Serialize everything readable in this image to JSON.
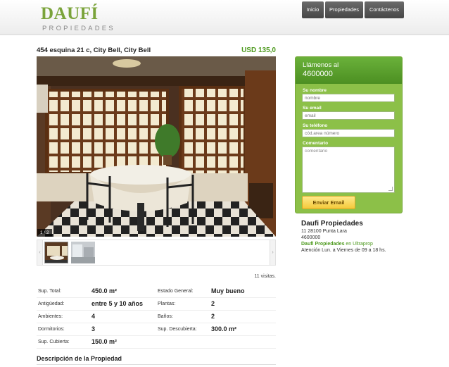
{
  "header": {
    "logo_word": "DAUFÍ",
    "logo_sub": "PROPIEDADES",
    "nav": [
      "Inicio",
      "Propiedades",
      "Contáctenos"
    ]
  },
  "property": {
    "title": "454 esquina 21 c, City Bell, City Bell",
    "price": "USD  135,0",
    "photo_counter": "1 / 2",
    "visits": "11 visitas."
  },
  "specs": [
    {
      "label1": "Sup. Total:",
      "value1": "450.0 m²",
      "label2": "Estado General:",
      "value2": "Muy bueno"
    },
    {
      "label1": "Antigüedad:",
      "value1": "entre 5 y 10 años",
      "label2": "Plantas:",
      "value2": "2"
    },
    {
      "label1": "Ambientes:",
      "value1": "4",
      "label2": "Baños:",
      "value2": "2"
    },
    {
      "label1": "Dormitorios:",
      "value1": "3",
      "label2": "Sup. Descubierta:",
      "value2": "300.0 m²"
    },
    {
      "label1": "Sup. Cubierta:",
      "value1": "150.0 m²",
      "label2": "",
      "value2": ""
    }
  ],
  "description_title": "Descripción de la Propiedad",
  "contact": {
    "call_label": "Llámenos al",
    "call_number": "4600000",
    "name_label": "Su nombre",
    "name_placeholder": "nombre",
    "email_label": "Su email",
    "email_placeholder": "email",
    "phone_label": "Su teléfono",
    "phone_placeholder": "cód.area número",
    "comment_label": "Comentario",
    "comment_placeholder": "comentario",
    "send_label": "Enviar Email"
  },
  "agency": {
    "name": "Daufi Propiedades",
    "address": "11 28100 Punta Lara",
    "phone": "4600000",
    "link_bold": "Daufi Propiedades",
    "link_rest": " en Ultraprop",
    "hours": "Atención Lun. a Viernes de 09 a 18 hs."
  },
  "colors": {
    "brand_green": "#7aa33a",
    "panel_green": "#8cc048",
    "price_green": "#4e9a1f",
    "button_yellow": "#f4c93a",
    "nav_dark": "#555555"
  }
}
